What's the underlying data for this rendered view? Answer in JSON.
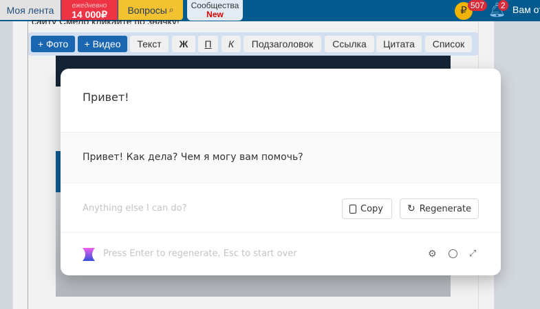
{
  "topnav": {
    "feed": "Моя лента",
    "promo_top": "ежедневно",
    "promo_amount": "14 000₽",
    "questions": "Вопросы",
    "communities": "Сообщества",
    "communities_badge": "New",
    "coins_badge": "507",
    "notif_badge": "2",
    "user_text": "Вам от"
  },
  "page": {
    "partial_text": "сайту Смело кликайте по значку!"
  },
  "toolbar": [
    "+ Фото",
    "+ Видео",
    "Текст",
    "Ж",
    "П",
    "К",
    "Подзаголовок",
    "Ссылка",
    "Цитата",
    "Список"
  ],
  "modal": {
    "user_message": "Привет!",
    "reply": "Привет! Как дела? Чем я могу вам помочь?",
    "followup_placeholder": "Anything else I can do?",
    "copy_label": "Copy",
    "regenerate_label": "Regenerate",
    "hint": "Press Enter to regenerate, Esc to start over"
  },
  "colors": {
    "nav": "#035a8f",
    "accent_blue": "#1a66b0",
    "promo": "#ee3344",
    "questions": "#f3c230"
  }
}
